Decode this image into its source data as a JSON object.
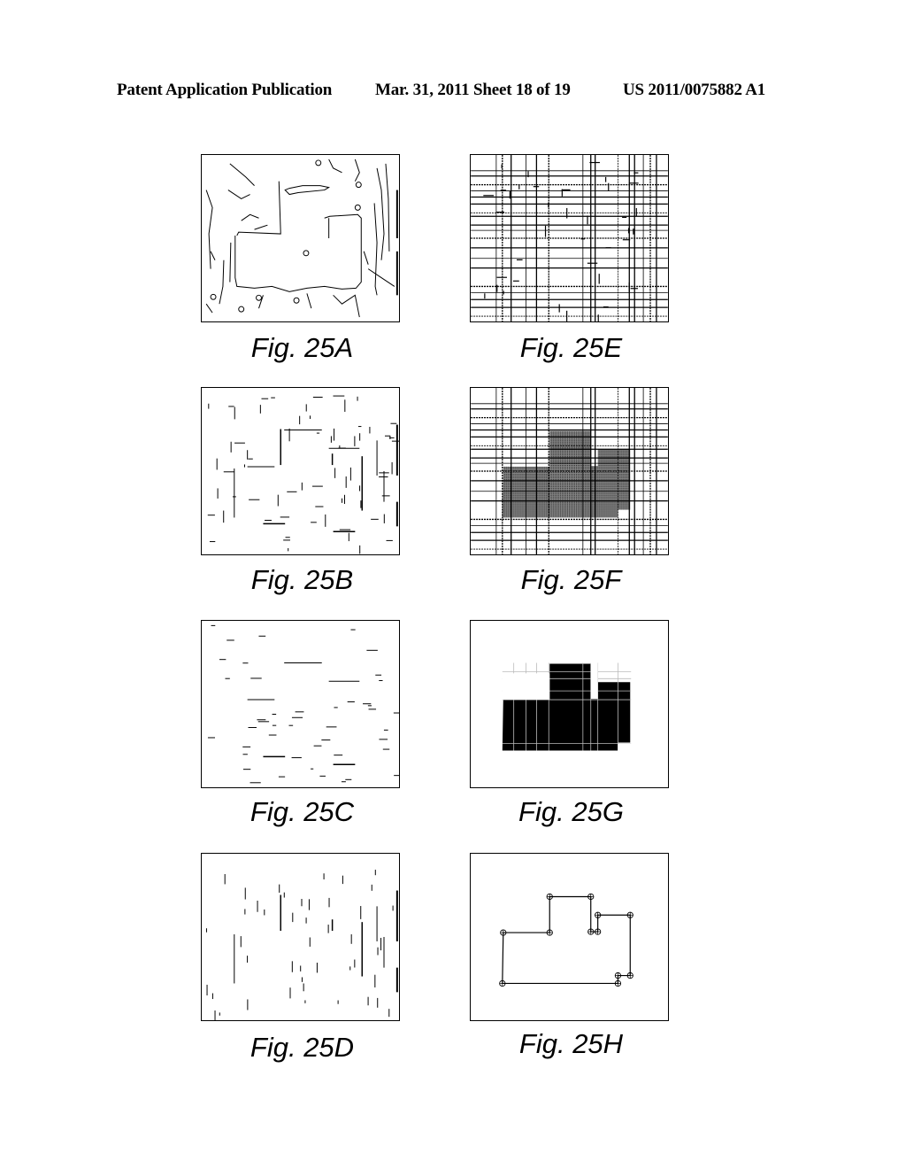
{
  "header": {
    "publication": "Patent Application Publication",
    "date_sheet": "Mar. 31, 2011  Sheet 18 of 19",
    "number": "US 2011/0075882 A1"
  },
  "figures": [
    {
      "id": "25A",
      "caption": "Fig. 25A",
      "content": "edge-detection contour image"
    },
    {
      "id": "25B",
      "caption": "Fig. 25B",
      "content": "horizontal and vertical line segments"
    },
    {
      "id": "25C",
      "caption": "Fig. 25C",
      "content": "horizontal line segments"
    },
    {
      "id": "25D",
      "caption": "Fig. 25D",
      "content": "vertical line segments"
    },
    {
      "id": "25E",
      "caption": "Fig. 25E",
      "content": "grid of extended lines over segments"
    },
    {
      "id": "25F",
      "caption": "Fig. 25F",
      "content": "grid with shaded building footprint cells"
    },
    {
      "id": "25G",
      "caption": "Fig. 25G",
      "content": "filled footprint cells"
    },
    {
      "id": "25H",
      "caption": "Fig. 25H",
      "content": "footprint polygon with vertex markers"
    }
  ]
}
